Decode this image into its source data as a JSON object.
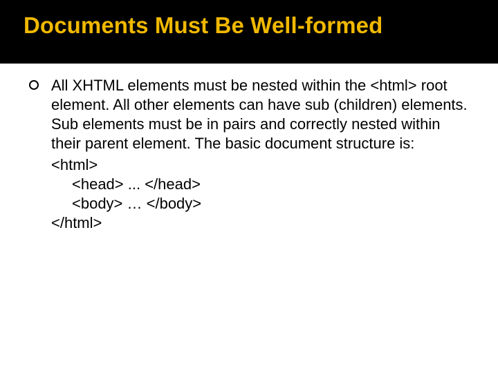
{
  "slide": {
    "title": "Documents Must Be Well-formed",
    "paragraph": "All XHTML elements must be nested within the <html> root element.  All other elements can have sub (children) elements.  Sub elements must be in pairs and correctly nested within their parent element.  The basic document structure is:",
    "structure": {
      "open_html": "<html>",
      "head_line": "<head> ... </head>",
      "body_line": "<body> … </body>",
      "close_html": "</html>"
    }
  }
}
